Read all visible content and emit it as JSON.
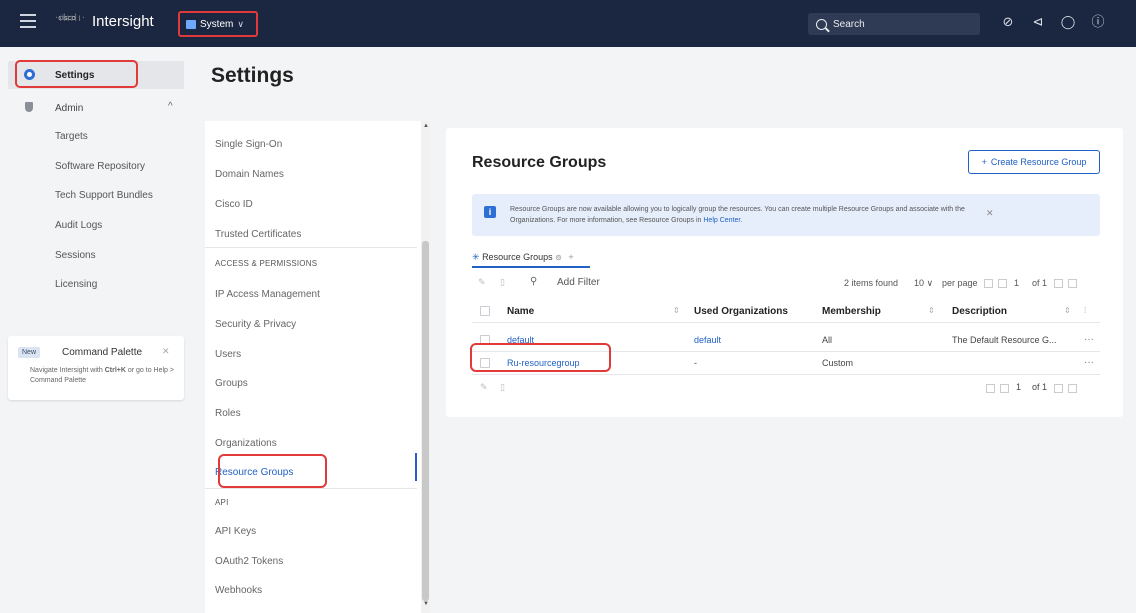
{
  "topbar": {
    "app_title": "Intersight",
    "logo_line1": "·ılıılı·",
    "logo_line2": "cisco",
    "scope_label": "System",
    "search_label": "Search"
  },
  "leftnav": {
    "settings": "Settings",
    "admin": "Admin",
    "admin_items": [
      "Targets",
      "Software Repository",
      "Tech Support Bundles",
      "Audit Logs",
      "Sessions",
      "Licensing"
    ],
    "command_palette": {
      "badge": "New",
      "title": "Command Palette",
      "desc_part1": "Navigate Intersight with ",
      "shortcut": "Ctrl+K",
      "desc_part2": " or go to Help > Command Palette"
    }
  },
  "page": {
    "title": "Settings"
  },
  "settings_nav": {
    "single_sign_on": "Single Sign-On",
    "domain_names": "Domain Names",
    "cisco_id": "Cisco ID",
    "trusted_certificates": "Trusted Certificates",
    "access_header": "ACCESS & PERMISSIONS",
    "ip_access": "IP Access Management",
    "security_privacy": "Security & Privacy",
    "users": "Users",
    "groups": "Groups",
    "roles": "Roles",
    "organizations": "Organizations",
    "resource_groups": "Resource Groups",
    "api_header": "API",
    "api_keys": "API Keys",
    "oauth2": "OAuth2 Tokens",
    "webhooks": "Webhooks"
  },
  "content": {
    "title": "Resource Groups",
    "create_button": "Create Resource Group",
    "banner_text": "Resource Groups are now available allowing you to logically group the resources. You can create multiple Resource Groups and associate with the Organizations. For more information, see Resource Groups in ",
    "banner_link": "Help Center.",
    "tab_label": "Resource Groups",
    "filter_placeholder": "Add Filter",
    "items_found": "2 items found",
    "per_page_value": "10",
    "per_page_label": "per page",
    "page_current": "1",
    "page_of": "of 1",
    "columns": {
      "name": "Name",
      "used_orgs": "Used Organizations",
      "membership": "Membership",
      "description": "Description"
    },
    "rows": [
      {
        "name": "default",
        "used_orgs": "default",
        "membership": "All",
        "description": "The Default Resource G..."
      },
      {
        "name": "Ru-resourcegroup",
        "used_orgs": "-",
        "membership": "Custom",
        "description": ""
      }
    ]
  },
  "colors": {
    "topbar": "#1b2740",
    "accent": "#2160c4",
    "highlight": "#e03a3a"
  }
}
